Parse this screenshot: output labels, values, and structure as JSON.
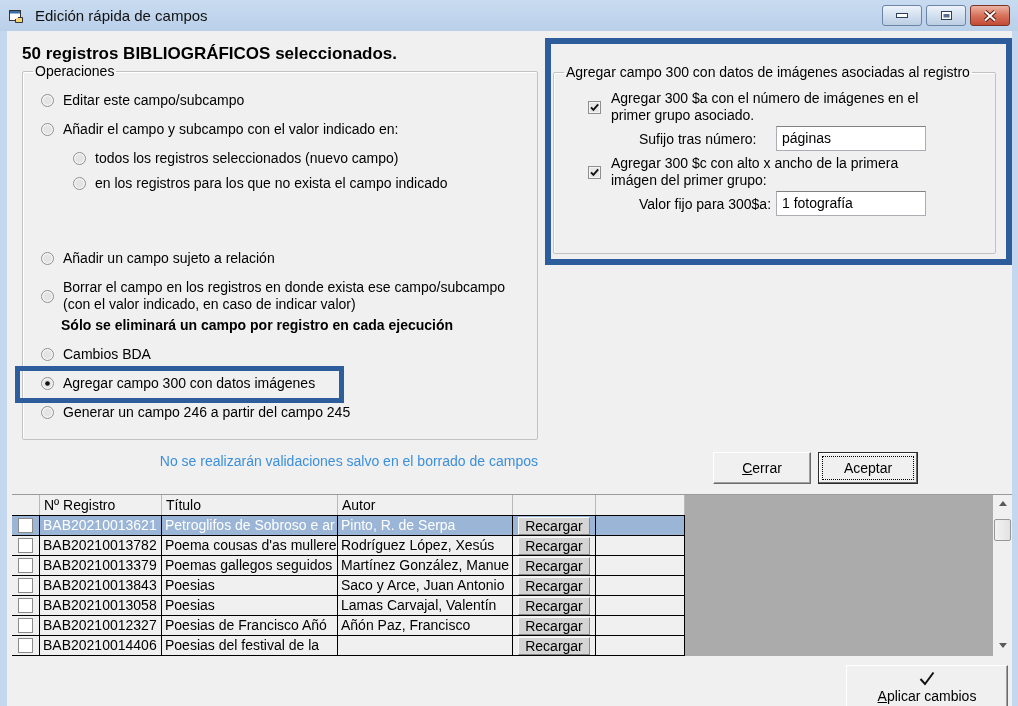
{
  "window": {
    "title": "Edición rápida de campos"
  },
  "heading": "50 registros BIBLIOGRÁFICOS seleccionados.",
  "operations": {
    "title": "Operaciones",
    "options": [
      {
        "label": "Editar este campo/subcampo",
        "selected": false,
        "highlighted": false
      },
      {
        "label": "Añadir el campo y subcampo con el valor indicado en:",
        "selected": false,
        "highlighted": false,
        "children": [
          {
            "label": "todos los registros seleccionados (nuevo campo)",
            "selected": false
          },
          {
            "label": "en los registros para los que no exista el campo indicado",
            "selected": false
          }
        ]
      },
      {
        "label": "Añadir un campo sujeto a relación",
        "selected": false,
        "highlighted": false
      },
      {
        "label": "Borrar el campo en los registros en donde exista ese campo/subcampo (con el valor indicado, en caso de indicar valor)",
        "selected": false,
        "highlighted": false,
        "note": "Sólo se eliminará un campo por registro en cada ejecución"
      },
      {
        "label": "Cambios BDA",
        "selected": false,
        "highlighted": false
      },
      {
        "label": "Agregar campo 300 con datos imágenes",
        "selected": true,
        "highlighted": true
      },
      {
        "label": "Generar un campo 246 a partir del campo 245",
        "selected": false,
        "highlighted": false
      }
    ]
  },
  "notice": "No se realizarán validaciones salvo en el borrado de campos",
  "image_options": {
    "highlighted": true,
    "title": "Agregar campo 300 con datos de imágenes asociadas al registro",
    "items": [
      {
        "label": "Agregar 300 $a con el número de imágenes en el primer grupo asociado.",
        "checked": true,
        "field": {
          "label": "Sufijo tras número:",
          "value": "páginas"
        }
      },
      {
        "label": "Agregar 300 $c con alto x ancho de la primera imágen del primer grupo:",
        "checked": true,
        "field": {
          "label": "Valor fijo para 300$a:",
          "value": "1 fotografía"
        }
      }
    ]
  },
  "buttons": [
    {
      "label": "Cerrar",
      "access_key": true,
      "focused": false
    },
    {
      "label": "Aceptar",
      "access_key": false,
      "focused": true
    }
  ],
  "table": {
    "columns": [
      "Nº Registro",
      "Título",
      "Autor"
    ],
    "rows": [
      {
        "checked": false,
        "selected": true,
        "record_no": "BAB20210013621",
        "title": "Petroglifos de Sobroso e ar",
        "author": "Pinto, R. de Serpa",
        "action": "Recargar"
      },
      {
        "checked": false,
        "selected": false,
        "record_no": "BAB20210013782",
        "title": "Poema cousas d'as mullere",
        "author": "Rodríguez López, Xesús",
        "action": "Recargar"
      },
      {
        "checked": false,
        "selected": false,
        "record_no": "BAB20210013379",
        "title": "Poemas gallegos seguidos",
        "author": "Martínez González, Manue",
        "action": "Recargar"
      },
      {
        "checked": false,
        "selected": false,
        "record_no": "BAB20210013843",
        "title": "Poesias",
        "author": "Saco y Arce, Juan Antonio",
        "action": "Recargar"
      },
      {
        "checked": false,
        "selected": false,
        "record_no": "BAB20210013058",
        "title": "Poesias",
        "author": "Lamas Carvajal, Valentín",
        "action": "Recargar"
      },
      {
        "checked": false,
        "selected": false,
        "record_no": "BAB20210012327",
        "title": "Poesias de Francisco Añó",
        "author": "Añón Paz, Francisco",
        "action": "Recargar"
      },
      {
        "checked": false,
        "selected": false,
        "record_no": "BAB20210014406",
        "title": "Poesias del festival de la",
        "action": "Recargar"
      }
    ]
  },
  "apply_button": {
    "label": "Aplicar cambios",
    "access_key": true
  }
}
